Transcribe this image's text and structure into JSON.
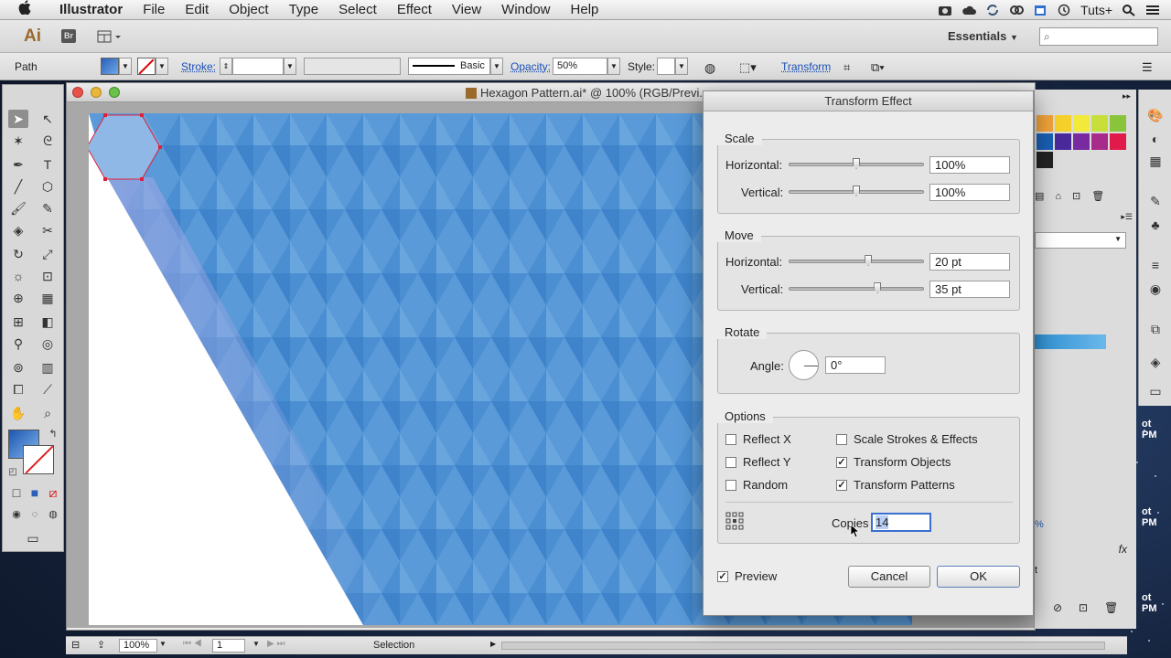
{
  "menubar": {
    "apple": "",
    "items": [
      "Illustrator",
      "File",
      "Edit",
      "Object",
      "Type",
      "Select",
      "Effect",
      "View",
      "Window",
      "Help"
    ],
    "right_label": "Tuts+"
  },
  "appbar": {
    "logo": "Ai",
    "bridge": "Br",
    "workspace": "Essentials",
    "search_placeholder": ""
  },
  "controlbar": {
    "selection_type": "Path",
    "stroke_label": "Stroke:",
    "brush": "Basic",
    "opacity_label": "Opacity:",
    "opacity_value": "50%",
    "style_label": "Style:",
    "transform_link": "Transform"
  },
  "document": {
    "title": "Hexagon Pattern.ai* @ 100% (RGB/Previ..."
  },
  "statusbar": {
    "zoom": "100%",
    "artboard": "1",
    "tool": "Selection"
  },
  "right_panel": {
    "pm_labels": [
      "ot\nPM",
      "ot\nPM",
      "ot\nPM"
    ],
    "fx": "fx",
    "percent": "%",
    "t": "t"
  },
  "colors": {
    "accent": "#3a6fd0",
    "pattern_light": "#8fb8e6",
    "pattern_dark": "#3b86cc",
    "hex_selection": "#e0203a"
  },
  "dialog": {
    "title": "Transform Effect",
    "scale": {
      "legend": "Scale",
      "horizontal_label": "Horizontal:",
      "horizontal_value": "100%",
      "horizontal_pos": 0.5,
      "vertical_label": "Vertical:",
      "vertical_value": "100%",
      "vertical_pos": 0.5
    },
    "move": {
      "legend": "Move",
      "horizontal_label": "Horizontal:",
      "horizontal_value": "20 pt",
      "horizontal_pos": 0.59,
      "vertical_label": "Vertical:",
      "vertical_value": "35 pt",
      "vertical_pos": 0.66
    },
    "rotate": {
      "legend": "Rotate",
      "angle_label": "Angle:",
      "angle_value": "0°"
    },
    "options": {
      "legend": "Options",
      "reflect_x": "Reflect X",
      "reflect_y": "Reflect Y",
      "random": "Random",
      "scale_strokes": "Scale Strokes & Effects",
      "transform_objects": "Transform Objects",
      "transform_patterns": "Transform Patterns",
      "copies_label": "Copies",
      "copies_value": "14"
    },
    "preview_label": "Preview",
    "cancel_label": "Cancel",
    "ok_label": "OK"
  }
}
